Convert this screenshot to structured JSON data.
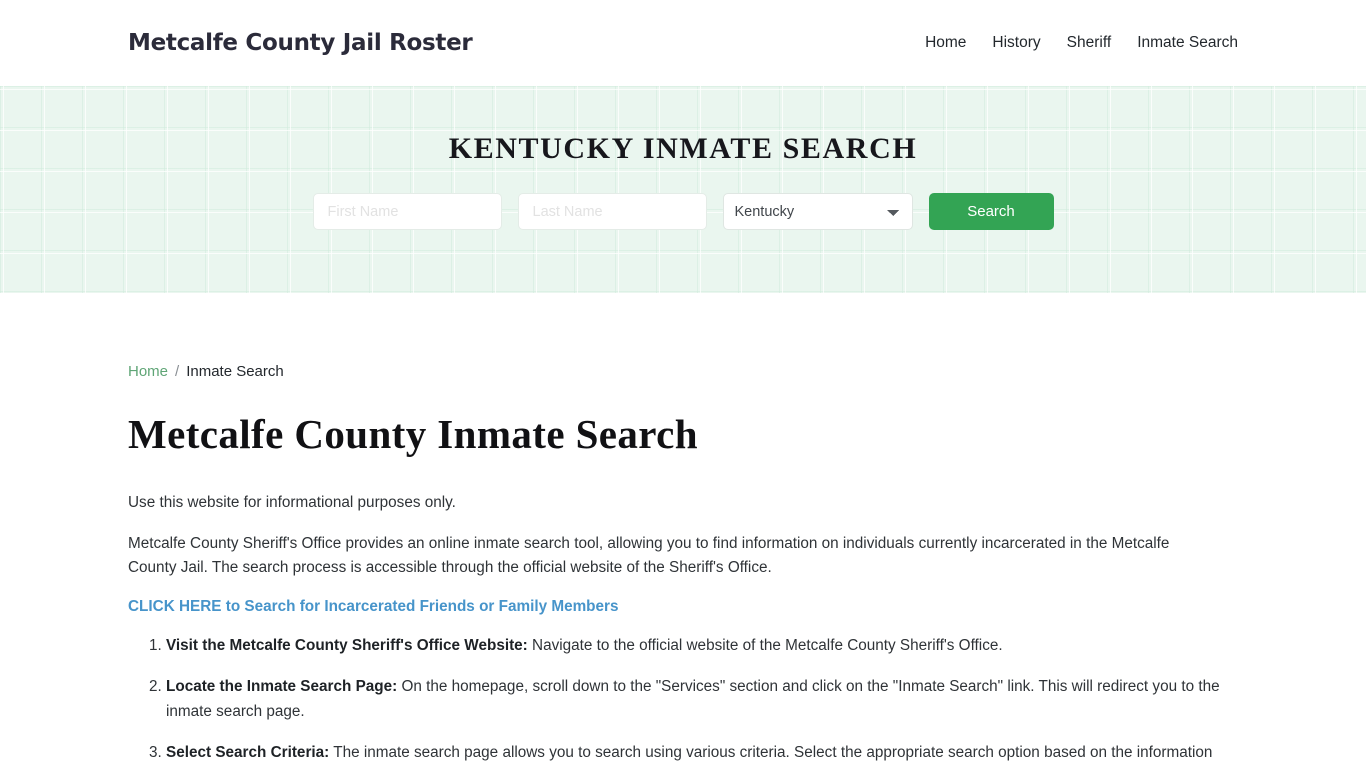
{
  "header": {
    "logo": "Metcalfe County Jail Roster",
    "nav": [
      {
        "label": "Home"
      },
      {
        "label": "History"
      },
      {
        "label": "Sheriff"
      },
      {
        "label": "Inmate Search"
      }
    ]
  },
  "hero": {
    "title": "KENTUCKY INMATE SEARCH",
    "first_name_placeholder": "First Name",
    "first_name_value": "",
    "last_name_placeholder": "Last Name",
    "last_name_value": "",
    "state_selected": "Kentucky",
    "state_options": [
      "Kentucky"
    ],
    "search_button": "Search",
    "background_color": "#eaf6ef",
    "button_color": "#33a454"
  },
  "breadcrumb": {
    "home": "Home",
    "separator": "/",
    "current": "Inmate Search",
    "link_color": "#5fa576"
  },
  "main": {
    "page_title": "Metcalfe County Inmate Search",
    "intro": "Use this website for informational purposes only.",
    "paragraph": "Metcalfe County Sheriff's Office provides an online inmate search tool, allowing you to find information on individuals currently incarcerated in the Metcalfe County Jail. The search process is accessible through the official website of the Sheriff's Office.",
    "cta_link": "CLICK HERE to Search for Incarcerated Friends or Family Members",
    "cta_color": "#4794ca",
    "steps": [
      {
        "label": "Visit the Metcalfe County Sheriff's Office Website:",
        "text": " Navigate to the official website of the Metcalfe County Sheriff's Office."
      },
      {
        "label": "Locate the Inmate Search Page:",
        "text": " On the homepage, scroll down to the \"Services\" section and click on the \"Inmate Search\" link. This will redirect you to the inmate search page."
      },
      {
        "label": "Select Search Criteria:",
        "text": " The inmate search page allows you to search using various criteria. Select the appropriate search option based on the information"
      }
    ]
  }
}
